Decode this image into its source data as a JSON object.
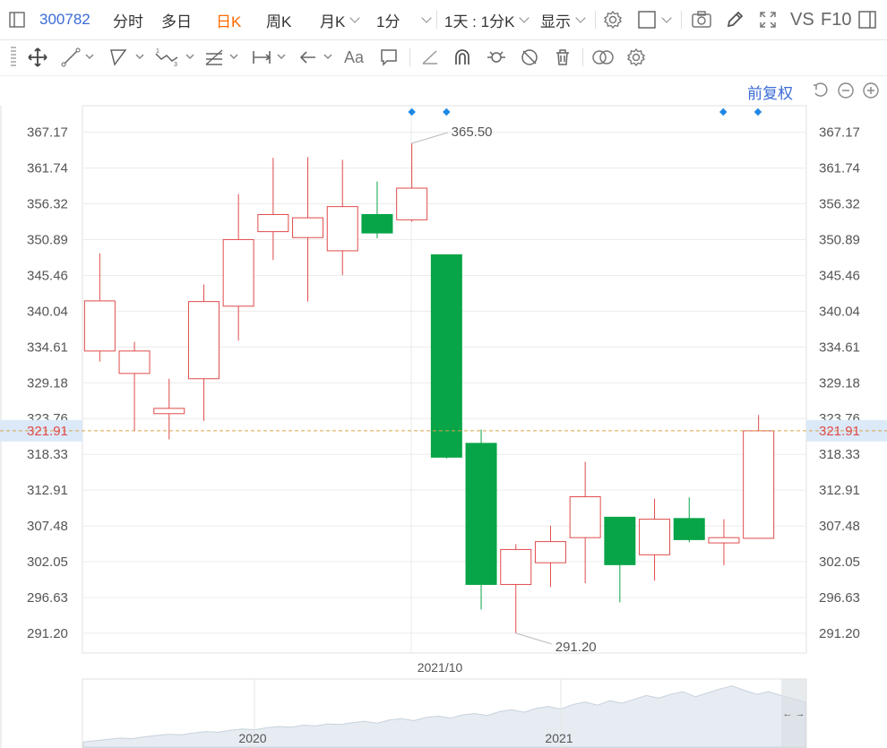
{
  "header": {
    "stock_code": "300782",
    "tabs": [
      {
        "label": "分时",
        "active": false
      },
      {
        "label": "多日",
        "active": false
      },
      {
        "label": "日K",
        "active": true
      },
      {
        "label": "周K",
        "active": false
      },
      {
        "label": "月K",
        "active": false
      },
      {
        "label": "1分",
        "active": false
      },
      {
        "label": "1天 : 1分K",
        "active": false
      },
      {
        "label": "显示",
        "active": false
      }
    ],
    "vs_label": "VS",
    "f10_label": "F10"
  },
  "subbar": {
    "adjust_label": "前复权"
  },
  "colors": {
    "up": "#e04b4b",
    "down": "#07a548",
    "last_price": "#e04b4b",
    "marker": "#1e88e5"
  },
  "chart_data": {
    "type": "candlestick",
    "ylim": [
      288.2,
      371.2
    ],
    "y_ticks": [
      367.17,
      361.74,
      356.32,
      350.89,
      345.46,
      340.04,
      334.61,
      329.18,
      323.76,
      318.33,
      312.91,
      307.48,
      302.05,
      296.63,
      291.2
    ],
    "x_label": "2021/10",
    "last_price": 321.91,
    "last_price_label": "321.91",
    "high_label": "365.50",
    "low_label": "291.20",
    "candles": [
      {
        "open": 334.0,
        "high": 348.8,
        "low": 332.4,
        "close": 341.6
      },
      {
        "open": 330.6,
        "high": 335.4,
        "low": 321.9,
        "close": 334.0
      },
      {
        "open": 324.5,
        "high": 329.8,
        "low": 320.6,
        "close": 325.3
      },
      {
        "open": 329.8,
        "high": 344.1,
        "low": 323.4,
        "close": 341.5
      },
      {
        "open": 340.8,
        "high": 357.8,
        "low": 335.6,
        "close": 350.9
      },
      {
        "open": 352.1,
        "high": 363.3,
        "low": 347.8,
        "close": 354.7
      },
      {
        "open": 351.2,
        "high": 363.4,
        "low": 341.5,
        "close": 354.2
      },
      {
        "open": 349.2,
        "high": 363.0,
        "low": 345.5,
        "close": 355.9
      },
      {
        "open": 354.7,
        "high": 359.7,
        "low": 351.1,
        "close": 351.9
      },
      {
        "open": 353.9,
        "high": 365.5,
        "low": 353.6,
        "close": 358.7
      },
      {
        "open": 348.6,
        "high": 348.6,
        "low": 317.7,
        "close": 317.9
      },
      {
        "open": 320.0,
        "high": 322.1,
        "low": 294.8,
        "close": 298.6
      },
      {
        "open": 298.6,
        "high": 304.7,
        "low": 291.2,
        "close": 303.9
      },
      {
        "open": 301.9,
        "high": 307.5,
        "low": 298.2,
        "close": 305.1
      },
      {
        "open": 305.7,
        "high": 317.2,
        "low": 298.8,
        "close": 311.9
      },
      {
        "open": 308.8,
        "high": 308.8,
        "low": 295.9,
        "close": 301.6
      },
      {
        "open": 303.1,
        "high": 311.6,
        "low": 299.2,
        "close": 308.5
      },
      {
        "open": 308.6,
        "high": 311.8,
        "low": 305.0,
        "close": 305.4
      },
      {
        "open": 304.9,
        "high": 308.5,
        "low": 301.5,
        "close": 305.7
      },
      {
        "open": 305.6,
        "high": 324.3,
        "low": 305.6,
        "close": 321.9
      }
    ],
    "markers": [
      9,
      10,
      18,
      19
    ],
    "navigator": {
      "labels": [
        "2020",
        "2021"
      ],
      "profile": [
        0.08,
        0.1,
        0.12,
        0.14,
        0.13,
        0.16,
        0.18,
        0.2,
        0.19,
        0.22,
        0.24,
        0.23,
        0.26,
        0.28,
        0.27,
        0.3,
        0.32,
        0.31,
        0.34,
        0.33,
        0.36,
        0.35,
        0.38,
        0.4,
        0.37,
        0.42,
        0.44,
        0.41,
        0.46,
        0.48,
        0.45,
        0.5,
        0.52,
        0.49,
        0.55,
        0.58,
        0.54,
        0.6,
        0.63,
        0.59,
        0.66,
        0.7,
        0.65,
        0.72,
        0.68,
        0.74,
        0.8,
        0.76,
        0.82,
        0.86,
        0.78,
        0.84,
        0.9,
        0.95,
        0.88,
        0.82,
        0.86,
        0.8,
        0.75,
        0.7
      ]
    }
  }
}
